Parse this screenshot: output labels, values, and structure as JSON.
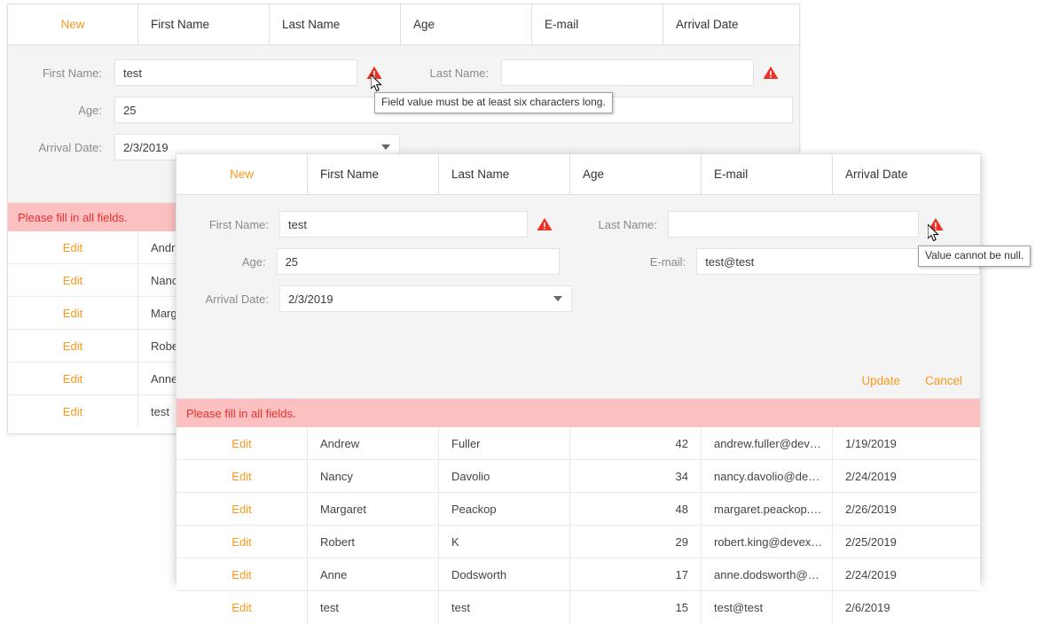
{
  "theme": {
    "accent": "#f8991d",
    "error_text": "#e8312f",
    "error_bg": "#fcc0c0",
    "warning_icon": "#ee3124",
    "form_bg": "#f4f4f4",
    "border": "#e0e0e0"
  },
  "columns": {
    "command": "New",
    "first_name": "First Name",
    "last_name": "Last Name",
    "age": "Age",
    "email": "E-mail",
    "arrival_date": "Arrival Date"
  },
  "back_panel": {
    "form": {
      "first_name_label": "First Name:",
      "first_name_value": "test",
      "last_name_label": "Last Name:",
      "last_name_value": "",
      "age_label": "Age:",
      "age_value": "25",
      "arrival_date_label": "Arrival Date:",
      "arrival_date_value": "2/3/2019"
    },
    "error_message": "Please fill in all fields.",
    "rows": [
      {
        "command": "Edit",
        "first_name": "Andrew"
      },
      {
        "command": "Edit",
        "first_name": "Nancy"
      },
      {
        "command": "Edit",
        "first_name": "Margaret"
      },
      {
        "command": "Edit",
        "first_name": "Robert"
      },
      {
        "command": "Edit",
        "first_name": "Anne"
      },
      {
        "command": "Edit",
        "first_name": "test"
      }
    ]
  },
  "front_panel": {
    "form": {
      "first_name_label": "First Name:",
      "first_name_value": "test",
      "last_name_label": "Last Name:",
      "last_name_value": "",
      "age_label": "Age:",
      "age_value": "25",
      "email_label": "E-mail:",
      "email_value": "test@test",
      "arrival_date_label": "Arrival Date:",
      "arrival_date_value": "2/3/2019",
      "update_label": "Update",
      "cancel_label": "Cancel"
    },
    "error_message": "Please fill in all fields.",
    "rows": [
      {
        "command": "Edit",
        "first_name": "Andrew",
        "last_name": "Fuller",
        "age": "42",
        "email": "andrew.fuller@dev…",
        "arrival_date": "1/19/2019"
      },
      {
        "command": "Edit",
        "first_name": "Nancy",
        "last_name": "Davolio",
        "age": "34",
        "email": "nancy.davolio@de…",
        "arrival_date": "2/24/2019"
      },
      {
        "command": "Edit",
        "first_name": "Margaret",
        "last_name": "Peackop",
        "age": "48",
        "email": "margaret.peackop.…",
        "arrival_date": "2/26/2019"
      },
      {
        "command": "Edit",
        "first_name": "Robert",
        "last_name": "K",
        "age": "29",
        "email": "robert.king@devex…",
        "arrival_date": "2/25/2019"
      },
      {
        "command": "Edit",
        "first_name": "Anne",
        "last_name": "Dodsworth",
        "age": "17",
        "email": "anne.dodsworth@…",
        "arrival_date": "2/24/2019"
      },
      {
        "command": "Edit",
        "first_name": "test",
        "last_name": "test",
        "age": "15",
        "email": "test@test",
        "arrival_date": "2/6/2019"
      }
    ]
  },
  "tooltips": {
    "min_length": "Field value must be at least six characters long.",
    "not_null": "Value cannot be null."
  }
}
